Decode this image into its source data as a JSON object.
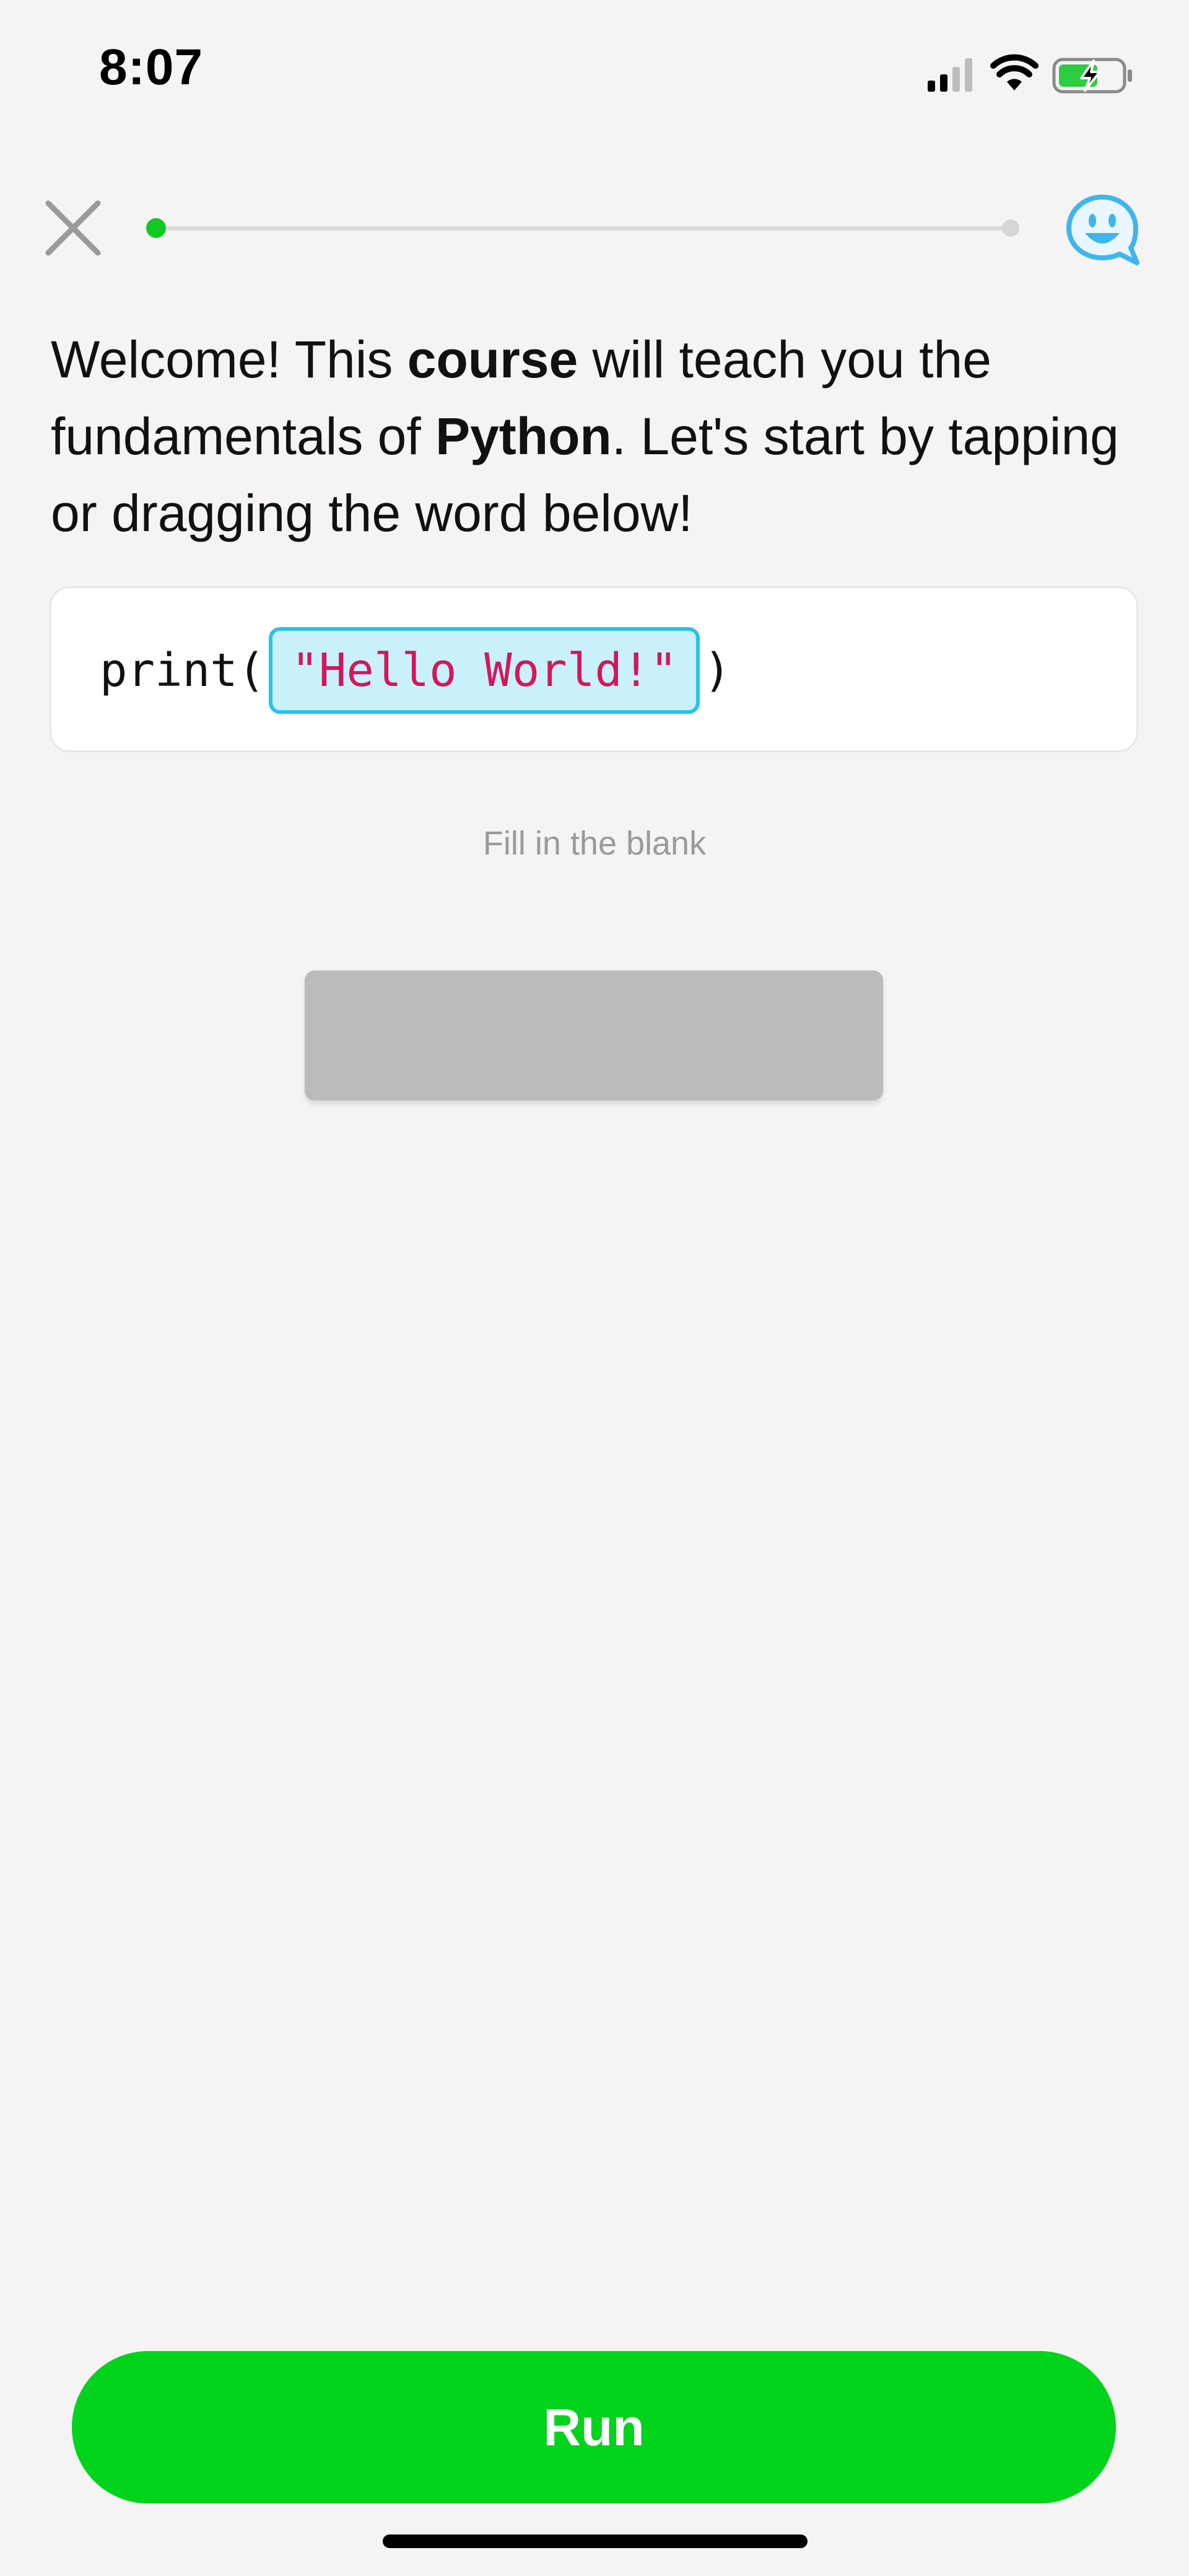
{
  "status_bar": {
    "time": "8:07",
    "icons": [
      "cellular-signal-icon",
      "wifi-icon",
      "battery-charging-icon"
    ]
  },
  "header": {
    "close_icon": "close-icon",
    "feedback_icon": "chat-smiley-icon",
    "progress_fraction": 0.0
  },
  "lesson": {
    "instruction_parts": [
      {
        "text": "Welcome!  This ",
        "bold": false
      },
      {
        "text": "course",
        "bold": true
      },
      {
        "text": " will teach you the fundamentals of ",
        "bold": false
      },
      {
        "text": "Python",
        "bold": true
      },
      {
        "text": ". Let's start by tapping or dragging the word below!",
        "bold": false
      }
    ],
    "code": {
      "prefix": "print(",
      "token": "\"Hello World!\"",
      "suffix": ")"
    },
    "hint": "Fill in the blank",
    "answer_slot_value": ""
  },
  "actions": {
    "run_label": "Run"
  },
  "colors": {
    "background": "#f5f3f4",
    "accent_green": "#03d31c",
    "progress_green": "#12c924",
    "token_border": "#27c3ea",
    "token_fill": "#c9f1fb",
    "string_color": "#d2185a",
    "feedback_blue": "#3eb6ec"
  }
}
